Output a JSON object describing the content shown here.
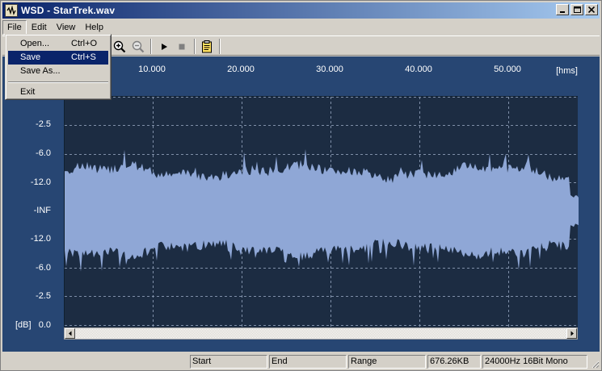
{
  "window": {
    "title": "WSD - StarTrek.wav"
  },
  "menu": [
    "File",
    "Edit",
    "View",
    "Help"
  ],
  "file_menu": {
    "items": [
      {
        "label": "Open...",
        "shortcut": "Ctrl+O"
      },
      {
        "label": "Save",
        "shortcut": "Ctrl+S"
      },
      {
        "label": "Save As...",
        "shortcut": ""
      },
      {
        "label": "Exit",
        "shortcut": ""
      }
    ],
    "highlighted": "Save"
  },
  "toolbar": {
    "icons": [
      "zoom-in-icon",
      "zoom-out-icon",
      "play-icon",
      "stop-icon",
      "properties-icon"
    ]
  },
  "waveform": {
    "time_ticks": [
      "10.000",
      "20.000",
      "30.000",
      "40.000",
      "50.000"
    ],
    "time_unit": "[hms]",
    "db_ticks": [
      "-2.5",
      "-6.0",
      "-12.0",
      "-INF",
      "-12.0",
      "-6.0",
      "-2.5",
      "0.0"
    ],
    "db_unit": "[dB]"
  },
  "statusbar": {
    "start": "Start",
    "end": "End",
    "range": "Range",
    "size": "676.26KB",
    "format": "24000Hz 16Bit Mono"
  },
  "colors": {
    "background": "#274673",
    "plot": "#1c2c42",
    "wave": "#8fa7d6",
    "titlebar": "#0a246a",
    "highlight": "#0a246a"
  }
}
